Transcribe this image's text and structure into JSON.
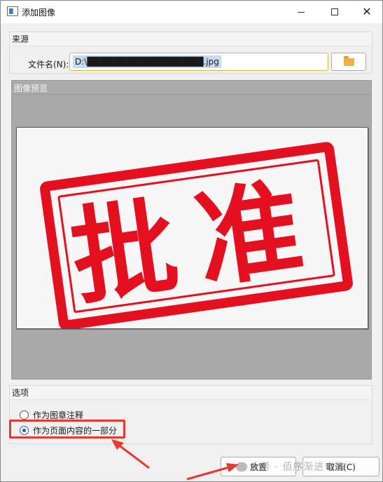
{
  "window": {
    "title": "添加图像",
    "minimize_glyph": "—",
    "maximize_glyph": "",
    "close_glyph": "✕"
  },
  "source": {
    "group_title": "来源",
    "file_label": "文件名(N):",
    "file_value": "D:\\██████████████████.jpg",
    "browse_icon": "folder-open-icon"
  },
  "preview": {
    "group_title": "图像预览",
    "stamp_text": "批准",
    "stamp_color": "#e5101f"
  },
  "options": {
    "group_title": "选项",
    "items": [
      {
        "label": "作为图章注释",
        "checked": false
      },
      {
        "label": "作为页面内容的一部分",
        "checked": true
      }
    ]
  },
  "buttons": {
    "place_label": "放置",
    "cancel_label": "取消(C)"
  },
  "watermark": {
    "text": "众号 · 佰序渐进电脑"
  },
  "colors": {
    "highlight": "#e53935",
    "accent": "#1f5eb8",
    "input_border": "#e0b53d"
  }
}
